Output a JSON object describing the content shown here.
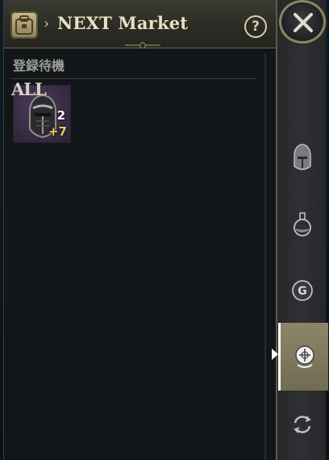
{
  "header": {
    "title": "NEXT Market",
    "help_label": "?"
  },
  "section": {
    "title": "登録待機"
  },
  "item": {
    "name": "helmet-item",
    "count": "2",
    "enhancement": "+7"
  },
  "rail": {
    "tabs": [
      {
        "label": "ALL",
        "icon": "all-text"
      },
      {
        "label": "",
        "icon": "helmet-icon"
      },
      {
        "label": "",
        "icon": "potion-icon"
      },
      {
        "label": "",
        "icon": "coin-g-icon"
      },
      {
        "label": "",
        "icon": "emblem-icon"
      },
      {
        "label": "",
        "icon": "refresh-icon"
      }
    ],
    "active_tab_index": 4
  },
  "colors": {
    "accent": "#d8cfaa",
    "active_tab": "#8d8768",
    "enhancement": "#e6cc55"
  }
}
